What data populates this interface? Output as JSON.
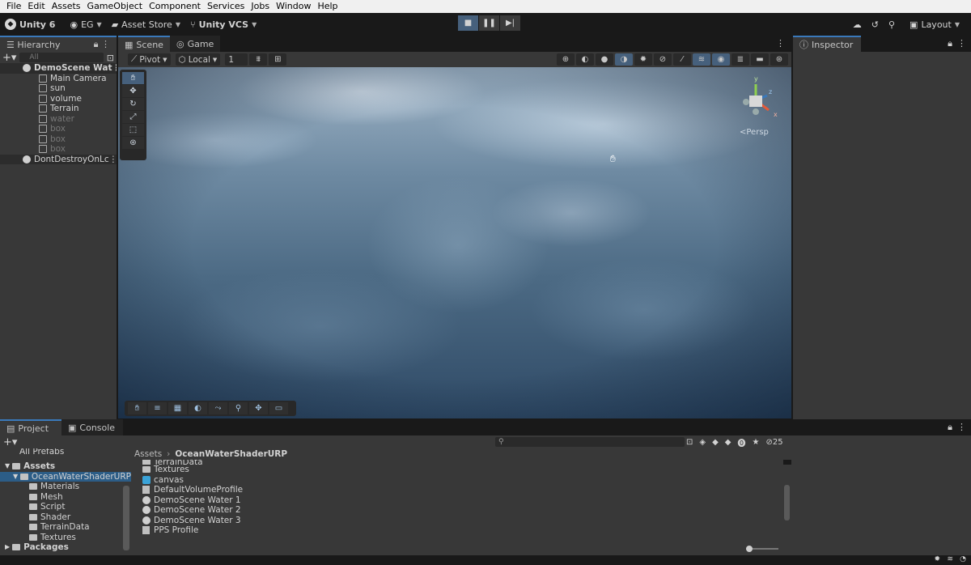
{
  "menu": [
    "File",
    "Edit",
    "Assets",
    "GameObject",
    "Component",
    "Services",
    "Jobs",
    "Window",
    "Help"
  ],
  "toolbar": {
    "product": "Unity 6",
    "account": "EG",
    "asset_store": "Asset Store",
    "vcs": "Unity VCS",
    "layout": "Layout"
  },
  "hierarchy": {
    "tab_label": "Hierarchy",
    "search_placeholder": "All",
    "scene_name": "DemoScene Wat",
    "children": [
      "Main Camera",
      "sun",
      "volume",
      "Terrain",
      "water",
      "box",
      "box",
      "box"
    ],
    "dont_destroy": "DontDestroyOnLc"
  },
  "scene_tabs": {
    "scene": "Scene",
    "game": "Game"
  },
  "scene_toolbar": {
    "pivot": "Pivot",
    "local": "Local",
    "grid_value": "1"
  },
  "gizmo": {
    "y": "y",
    "z": "z",
    "x": "x",
    "persp": "<Persp"
  },
  "inspector": {
    "tab_label": "Inspector"
  },
  "project": {
    "tab_project": "Project",
    "tab_console": "Console",
    "partial_top": "All Prefabs",
    "assets": "Assets",
    "selected_folder": "OceanWaterShaderURP",
    "subfolders": [
      "Materials",
      "Mesh",
      "Script",
      "Shader",
      "TerrainData",
      "Textures"
    ],
    "packages": "Packages",
    "breadcrumb_root": "Assets",
    "breadcrumb_current": "OceanWaterShaderURP",
    "files": [
      {
        "name": "TerrainData",
        "icon": "folder"
      },
      {
        "name": "Textures",
        "icon": "folder"
      },
      {
        "name": "canvas",
        "icon": "prefab"
      },
      {
        "name": "DefaultVolumeProfile",
        "icon": "asset"
      },
      {
        "name": "DemoScene Water 1",
        "icon": "scene"
      },
      {
        "name": "DemoScene Water 2",
        "icon": "scene"
      },
      {
        "name": "DemoScene Water 3",
        "icon": "scene"
      },
      {
        "name": "PPS Profile",
        "icon": "asset"
      }
    ],
    "hidden_count": "25"
  },
  "colors": {
    "accent": "#3a79bb",
    "selection": "#2c5d87",
    "panel": "#383838",
    "background": "#191919"
  }
}
